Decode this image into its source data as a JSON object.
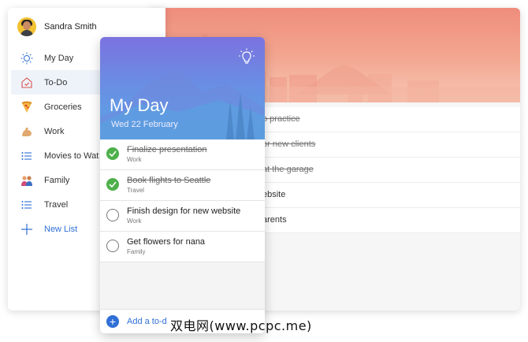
{
  "user": {
    "name": "Sandra Smith"
  },
  "sidebar": {
    "items": [
      {
        "label": "My Day",
        "icon": "sun-icon"
      },
      {
        "label": "To-Do",
        "icon": "home-icon"
      },
      {
        "label": "Groceries",
        "icon": "pizza-icon"
      },
      {
        "label": "Work",
        "icon": "flexed-arm-icon"
      },
      {
        "label": "Movies to Wat",
        "icon": "list-icon"
      },
      {
        "label": "Family",
        "icon": "family-icon"
      },
      {
        "label": "Travel",
        "icon": "list-icon"
      }
    ],
    "new_list": "New List"
  },
  "background_list": {
    "rows": [
      {
        "text": "o practice",
        "done": true
      },
      {
        "text": "or new clients",
        "done": true
      },
      {
        "text": "at the garage",
        "done": true
      },
      {
        "text": "ebsite",
        "done": false
      },
      {
        "text": "arents",
        "done": false
      }
    ]
  },
  "myday": {
    "title": "My Day",
    "date": "Wed 22 February",
    "tasks": [
      {
        "title": "Finalize presentation",
        "list": "Work",
        "done": true
      },
      {
        "title": "Book flights to Seattle",
        "list": "Travel",
        "done": true
      },
      {
        "title": "Finish design for new website",
        "list": "Work",
        "done": false
      },
      {
        "title": "Get flowers for nana",
        "list": "Family",
        "done": false
      }
    ],
    "add_label": "Add a to-d"
  },
  "watermark": "双电网(www.pcpc.me)",
  "colors": {
    "accent": "#2f6fd6",
    "check": "#4db04a"
  }
}
